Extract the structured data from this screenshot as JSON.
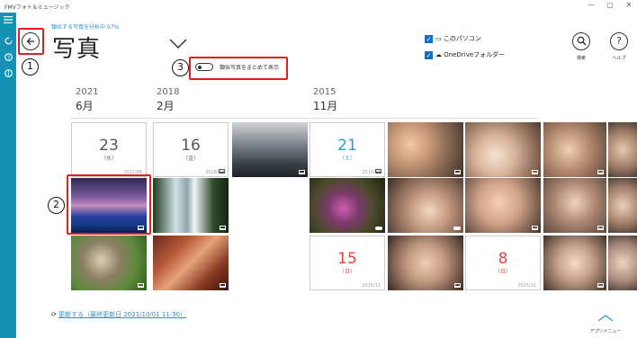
{
  "window": {
    "title": "FMVフォト＆ミュージック",
    "min": "—",
    "max": "▢",
    "close": "✕"
  },
  "status": {
    "progress": "類似する写真を分析中 97%"
  },
  "header": {
    "page_title": "写真"
  },
  "toggle": {
    "label": "類似写真をまとめて表示",
    "on": false
  },
  "sources": [
    {
      "label": "このパソコン",
      "checked": true
    },
    {
      "label": "OneDriveフォルダー",
      "checked": true
    }
  ],
  "tools": {
    "search_label": "検索",
    "help_label": "ヘルプ"
  },
  "timeline": {
    "groups": [
      {
        "year": "2021",
        "month": "6月"
      },
      {
        "year": "2018",
        "month": "2月"
      },
      {
        "year": "2015",
        "month": "11月"
      }
    ]
  },
  "date_tiles": {
    "d1": {
      "day": "23",
      "weekday": "（水）",
      "ym": "2021/06"
    },
    "d2": {
      "day": "16",
      "weekday": "（金）",
      "ym": "2018/02"
    },
    "d3": {
      "day": "21",
      "weekday": "（土）",
      "ym": "2015/11"
    },
    "d4": {
      "day": "15",
      "weekday": "（日）",
      "ym": "2015/11"
    },
    "d5": {
      "day": "8",
      "weekday": "（日）",
      "ym": "2015/11"
    }
  },
  "callouts": {
    "n1": "1",
    "n2": "2",
    "n3": "3"
  },
  "footer": {
    "update_link": "更新する（最終更新日 2021/10/01 11:30）",
    "app_menu": "アプリメニュー"
  },
  "colors": {
    "sidebar": "#1591b4",
    "accent_blue": "#2a9ad6",
    "sunday_red": "#e04848",
    "callout_red": "#e02020"
  }
}
